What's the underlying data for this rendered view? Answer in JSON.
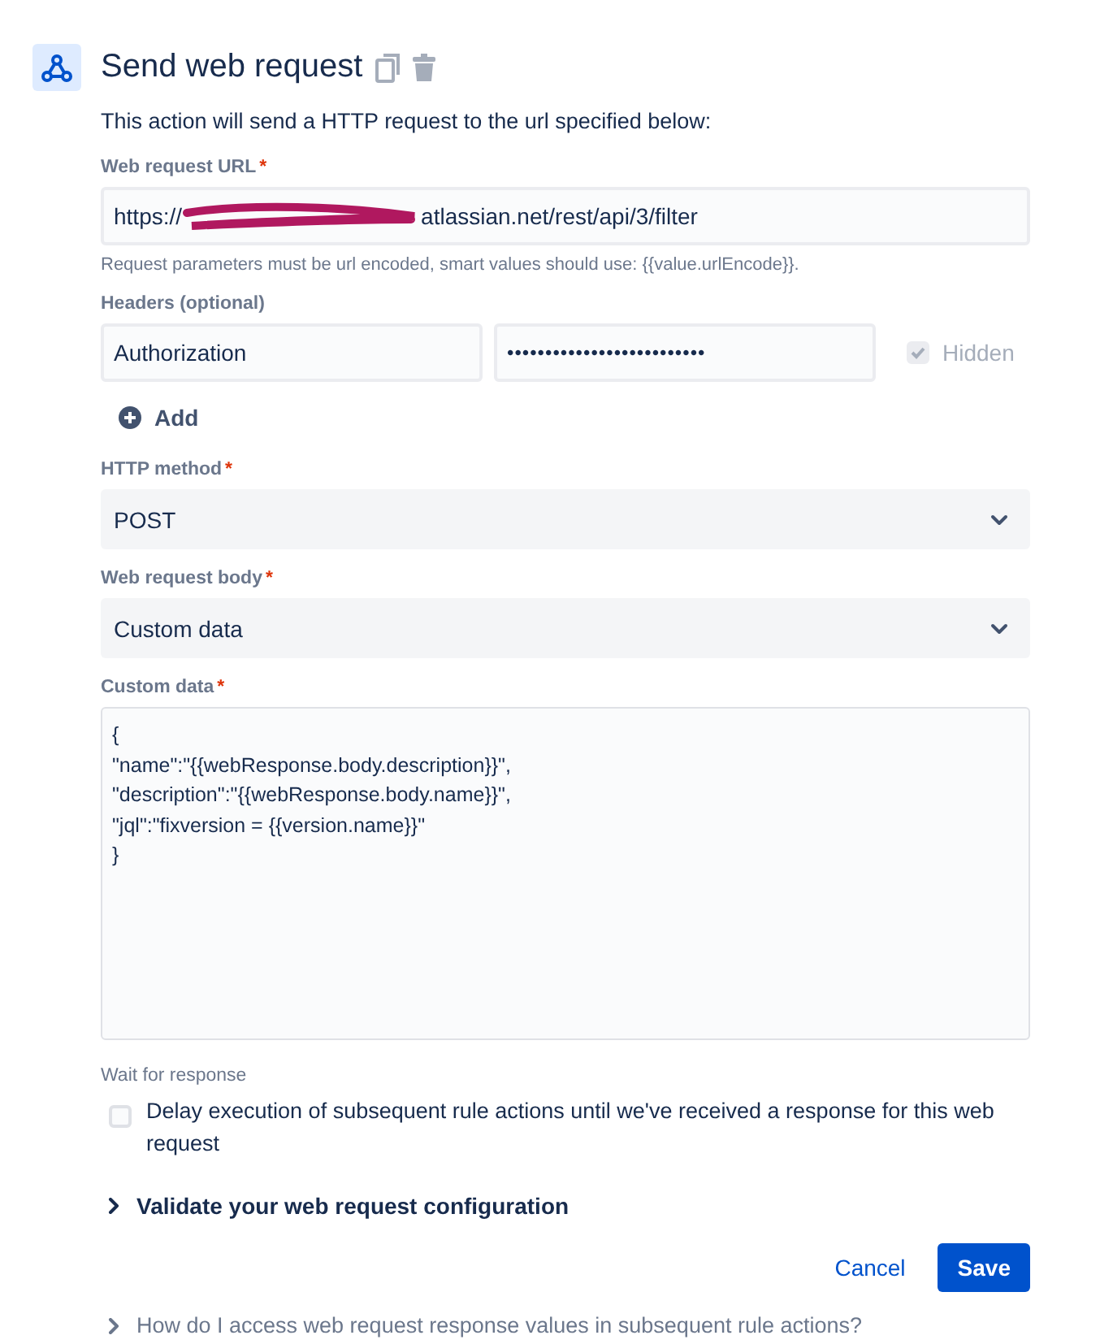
{
  "header": {
    "title": "Send web request"
  },
  "description": "This action will send a HTTP request to the url specified below:",
  "url": {
    "label": "Web request URL",
    "required_mark": "*",
    "value_start": "https://",
    "value_end": "atlassian.net/rest/api/3/filter",
    "help": "Request parameters must be url encoded, smart values should use: {{value.urlEncode}}."
  },
  "headers": {
    "label": "Headers (optional)",
    "rows": [
      {
        "name": "Authorization",
        "value": "••••••••••••••••••••••••••",
        "hidden": {
          "label": "Hidden",
          "checked": true,
          "disabled": true
        }
      }
    ],
    "add_label": "Add"
  },
  "method": {
    "label": "HTTP method",
    "required_mark": "*",
    "value": "POST"
  },
  "body": {
    "label": "Web request body",
    "required_mark": "*",
    "value": "Custom data"
  },
  "custom_data": {
    "label": "Custom data",
    "required_mark": "*",
    "lines": [
      "{",
      "\"name\":\"{{webResponse.body.description}}\",",
      "\"description\":\"{{webResponse.body.name}}\",",
      "\"jql\":\"fixversion = {{version.name}}\"",
      "}"
    ]
  },
  "wait": {
    "label": "Wait for response",
    "text": "Delay execution of subsequent rule actions until we've received a response for this web request",
    "checked": false
  },
  "validate": {
    "label": "Validate your web request configuration",
    "expanded": false
  },
  "buttons": [
    {
      "label": "Cancel",
      "kind": "link"
    },
    {
      "label": "Save",
      "kind": "primary"
    }
  ],
  "help_link": {
    "label": "How do I access web request response values in subsequent rule actions?",
    "expanded": false
  }
}
